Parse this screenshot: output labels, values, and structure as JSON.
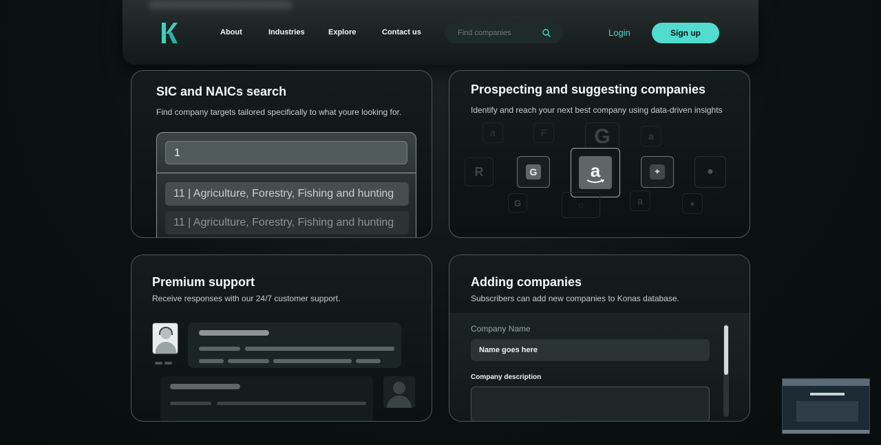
{
  "header": {
    "logo_letter": "K",
    "nav": [
      "About",
      "Industries",
      "Explore",
      "Contact us"
    ],
    "search": {
      "placeholder": "Find companies"
    },
    "login_label": "Login",
    "signup_label": "Sign up"
  },
  "sic_card": {
    "title": "SIC and NAICs search",
    "desc": "Find company targets tailored specifically to what youre looking for.",
    "input_value": "1",
    "options": [
      "11 | Agriculture, Forestry, Fishing and hunting",
      "11 | Agriculture, Forestry, Fishing and hunting"
    ]
  },
  "prospect_card": {
    "title": "Prospecting and suggesting companies",
    "desc": "Identify and reach your next best company using data-driven insights",
    "logos": [
      "amazon-icon",
      "google-icon",
      "figma-icon",
      "apple-icon",
      "r-logo-icon"
    ]
  },
  "support_card": {
    "title": "Premium support",
    "desc": "Receive responses with our 24/7 customer support."
  },
  "adding_card": {
    "title": "Adding companies",
    "desc": "Subscribers can add new companies to Konas database.",
    "company_name_label": "Company Name",
    "company_name_value": "Name goes here",
    "company_desc_label": "Company description"
  },
  "colors": {
    "accent": "#51dccf",
    "background": "#0b1111",
    "card_border": "#4c5958"
  }
}
